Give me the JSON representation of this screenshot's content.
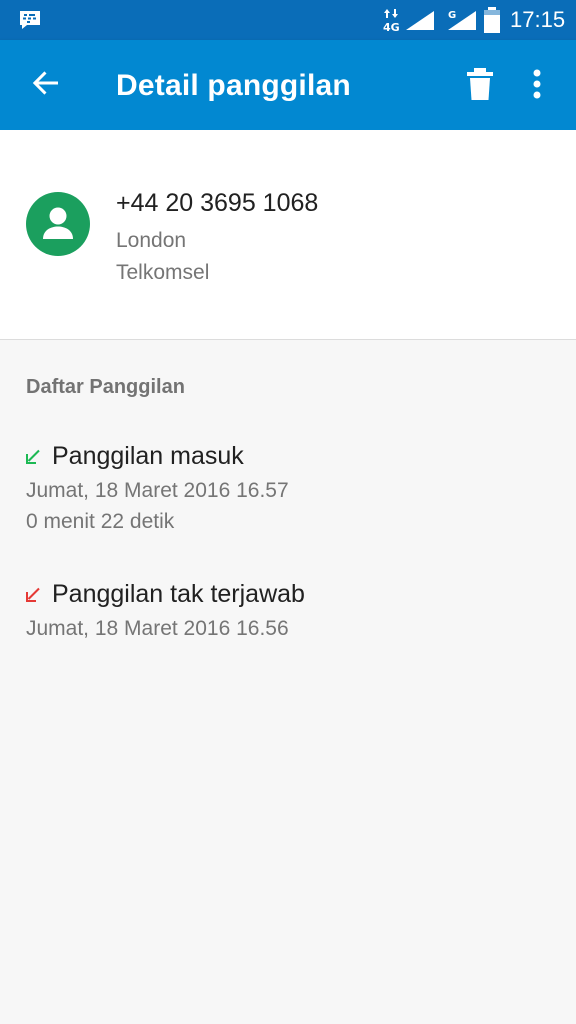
{
  "status_bar": {
    "network_label": "4G",
    "sim2_label": "G",
    "time": "17:15"
  },
  "app_bar": {
    "title": "Detail panggilan",
    "back_icon": "arrow-back-icon",
    "delete_icon": "trash-icon",
    "more_icon": "more-vert-icon"
  },
  "contact": {
    "number": "+44 20 3695 1068",
    "location": "London",
    "carrier": "Telkomsel",
    "avatar_color": "#1b9f5e"
  },
  "call_list": {
    "title": "Daftar Panggilan",
    "items": [
      {
        "type": "Panggilan masuk",
        "date": "Jumat, 18 Maret 2016 16.57",
        "duration": "0 menit 22 detik",
        "icon": "incoming-call-icon",
        "color": "#1db954"
      },
      {
        "type": "Panggilan tak terjawab",
        "date": "Jumat, 18 Maret 2016 16.56",
        "icon": "missed-call-icon",
        "color": "#e53935"
      }
    ]
  },
  "colors": {
    "status_bar": "#0a6db8",
    "app_bar": "#0288d1",
    "background": "#f7f7f7"
  }
}
